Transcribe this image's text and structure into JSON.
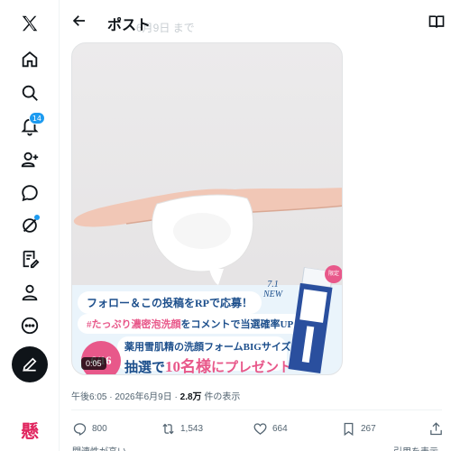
{
  "header": {
    "title": "ポスト",
    "ghost_text": "6月9日 まで"
  },
  "nav": {
    "notifications_badge": "14"
  },
  "media": {
    "banner_line1": "フォロー＆この投稿をRPで応募！",
    "banner_line2_pink": "#たっぷり濃密泡洗顔",
    "banner_line2_rest": "をコメントで当選確率UP",
    "banner_line3": "薬用雪肌精の洗顔フォームBIGサイズを",
    "banner_line4_a": "抽選で",
    "banner_line4_big": "10名様",
    "banner_line4_b": "にプレゼント",
    "date": "6/16",
    "new_label_date": "7.1",
    "new_label": "NEW",
    "limited_label": "限定",
    "duration": "0:05"
  },
  "meta": {
    "time": "午後6:05",
    "date": "2026年6月9日",
    "views": "2.8万",
    "views_suffix": "件の表示",
    "separator": "·"
  },
  "actions": {
    "replies": "800",
    "reposts": "1,543",
    "likes": "664",
    "bookmarks": "267"
  },
  "footer": {
    "left": "関連性が高い",
    "right": "引用を表示"
  },
  "colors": {
    "accent": "#1d9bf0",
    "pink": "#e8588a",
    "navy": "#1d4f8c"
  }
}
